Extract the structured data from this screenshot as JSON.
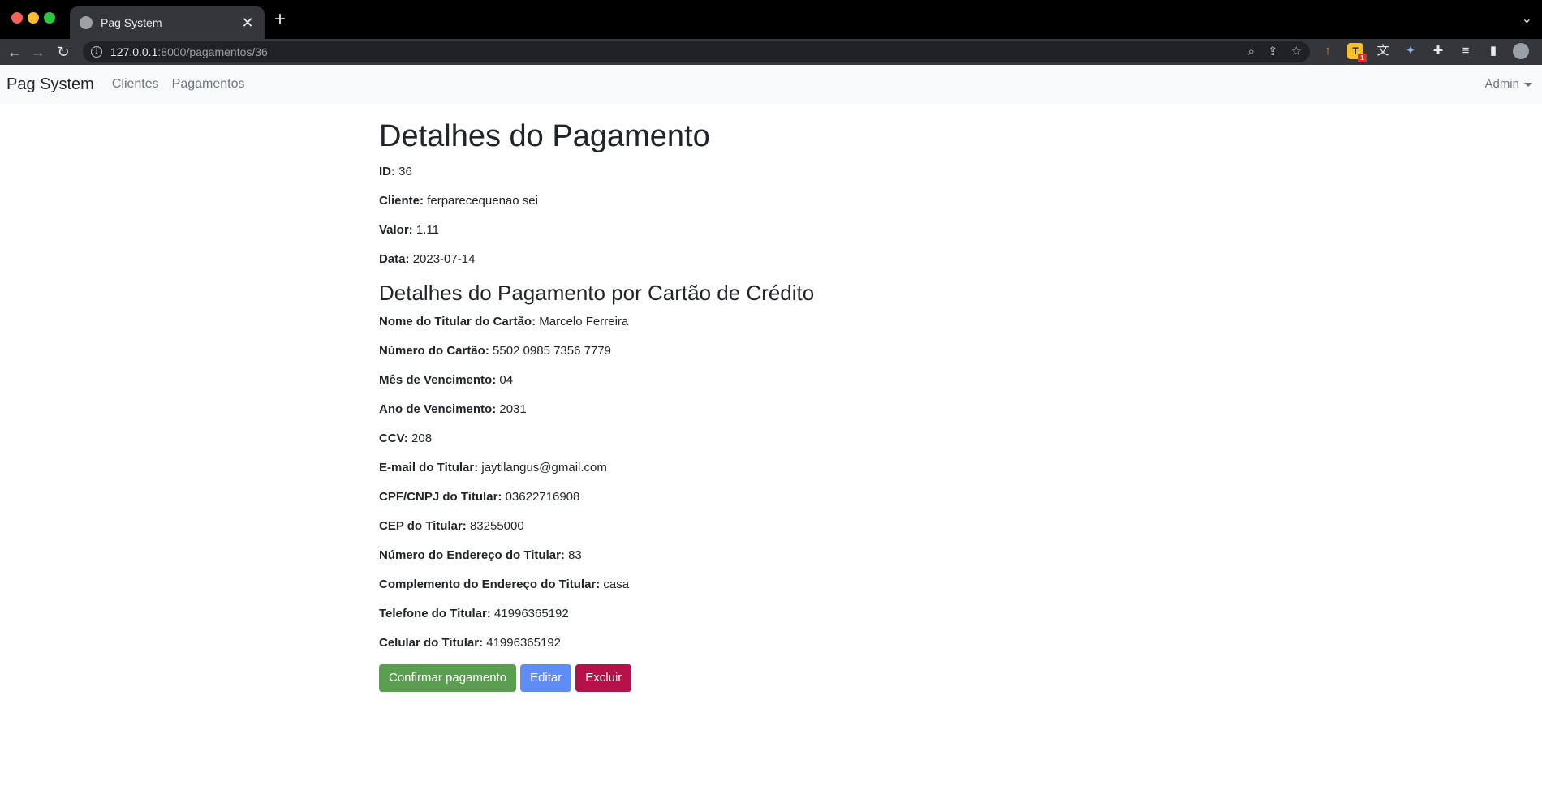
{
  "browser": {
    "tab_title": "Pag System",
    "tab_close": "✕",
    "new_tab": "+",
    "url_host": "127.0.0.1",
    "url_rest": ":8000/pagamentos/36",
    "icons": [
      "zoom-icon",
      "share-icon",
      "bookmark-star-icon",
      "extension-icons",
      "profile-avatar-icon"
    ]
  },
  "navbar": {
    "brand": "Pag System",
    "links": [
      "Clientes",
      "Pagamentos"
    ],
    "user_menu": "Admin"
  },
  "page": {
    "title": "Detalhes do Pagamento",
    "fields": [
      {
        "label": "ID:",
        "value": "36"
      },
      {
        "label": "Cliente:",
        "value": "ferparecequenao sei"
      },
      {
        "label": "Valor:",
        "value": "1.11"
      },
      {
        "label": "Data:",
        "value": "2023-07-14"
      }
    ],
    "card_section_title": "Detalhes do Pagamento por Cartão de Crédito",
    "card_fields": [
      {
        "label": "Nome do Titular do Cartão:",
        "value": "Marcelo Ferreira"
      },
      {
        "label": "Número do Cartão:",
        "value": "5502 0985 7356 7779"
      },
      {
        "label": "Mês de Vencimento:",
        "value": "04"
      },
      {
        "label": "Ano de Vencimento:",
        "value": "2031"
      },
      {
        "label": "CCV:",
        "value": "208"
      },
      {
        "label": "E-mail do Titular:",
        "value": "jaytilangus@gmail.com"
      },
      {
        "label": "CPF/CNPJ do Titular:",
        "value": "03622716908"
      },
      {
        "label": "CEP do Titular:",
        "value": "83255000"
      },
      {
        "label": "Número do Endereço do Titular:",
        "value": "83"
      },
      {
        "label": "Complemento do Endereço do Titular:",
        "value": "casa"
      },
      {
        "label": "Telefone do Titular:",
        "value": "41996365192"
      },
      {
        "label": "Celular do Titular:",
        "value": "41996365192"
      }
    ],
    "buttons": {
      "confirm": "Confirmar pagamento",
      "edit": "Editar",
      "delete": "Excluir"
    }
  },
  "colors": {
    "confirm": "#5a9e50",
    "edit": "#5f8df5",
    "delete": "#b5124a"
  }
}
